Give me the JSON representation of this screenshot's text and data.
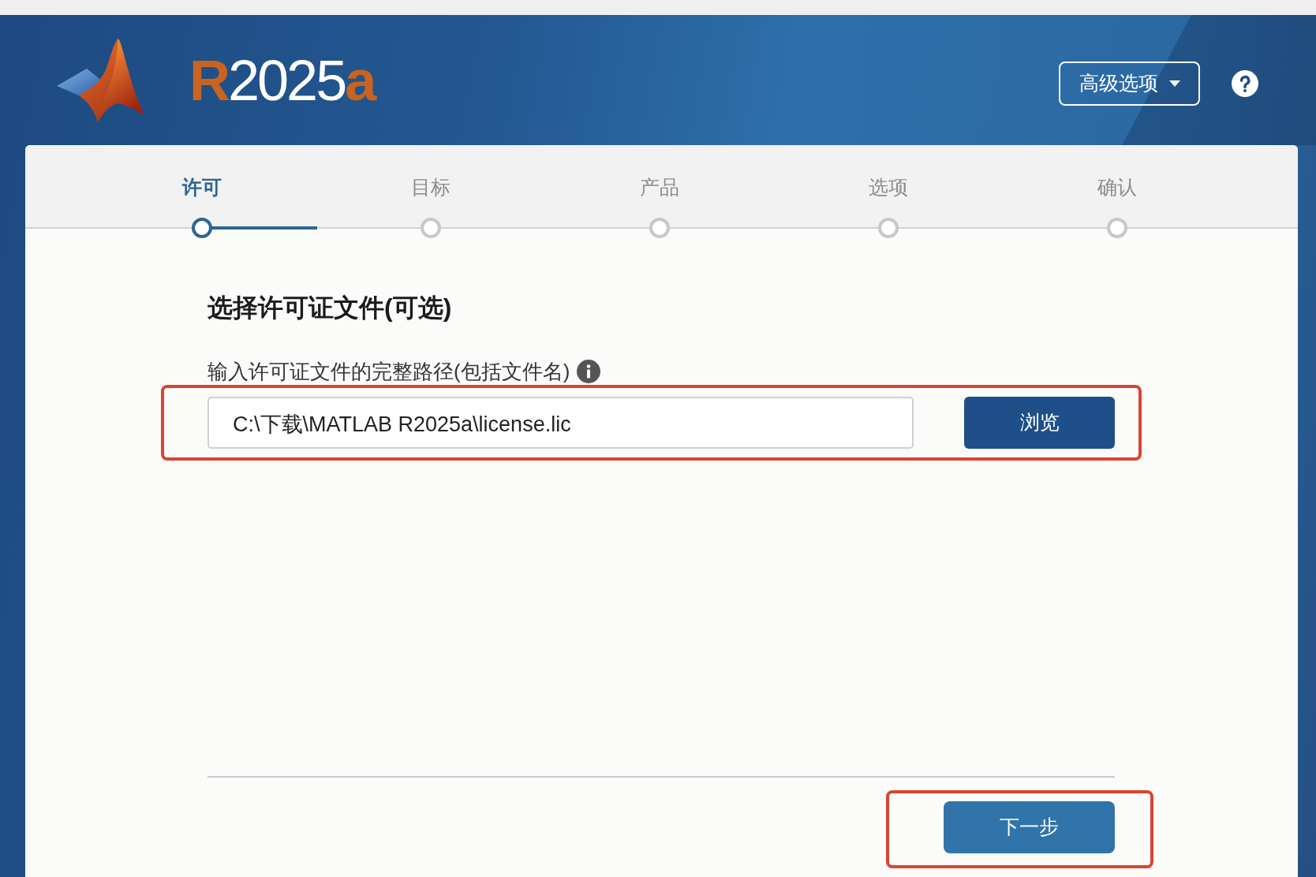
{
  "header": {
    "release": [
      {
        "text": "R",
        "accent": true
      },
      {
        "text": "2025",
        "accent": false
      },
      {
        "text": "a",
        "accent": true
      }
    ],
    "advanced_button": {
      "label": "高级选项"
    }
  },
  "steps": [
    {
      "label": "许可",
      "selected": true
    },
    {
      "label": "目标",
      "selected": false
    },
    {
      "label": "产品",
      "selected": false
    },
    {
      "label": "选项",
      "selected": false
    },
    {
      "label": "确认",
      "selected": false
    }
  ],
  "license": {
    "title": "选择许可证文件(可选)",
    "field_label": "输入许可证文件的完整路径(包括文件名)",
    "path_field": {
      "value": "C:\\下载\\MATLAB R2025a\\license.lic"
    },
    "browse_button": "浏览",
    "highlighted": true
  },
  "footer": {
    "next_button": {
      "label": "下一步",
      "highlighted": true
    }
  }
}
